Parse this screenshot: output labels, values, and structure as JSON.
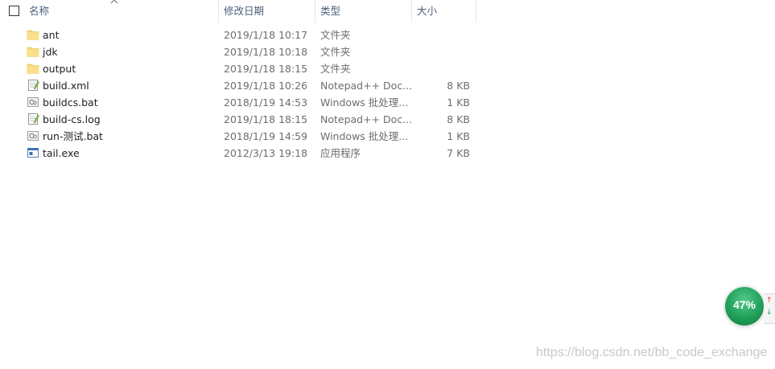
{
  "header": {
    "name": "名称",
    "date": "修改日期",
    "type": "类型",
    "size": "大小"
  },
  "files": [
    {
      "icon": "folder-icon",
      "name": "ant",
      "date": "2019/1/18 10:17",
      "type": "文件夹",
      "size": ""
    },
    {
      "icon": "folder-icon",
      "name": "jdk",
      "date": "2019/1/18 10:18",
      "type": "文件夹",
      "size": ""
    },
    {
      "icon": "folder-icon",
      "name": "output",
      "date": "2019/1/18 18:15",
      "type": "文件夹",
      "size": ""
    },
    {
      "icon": "notepad-icon",
      "name": "build.xml",
      "date": "2019/1/18 10:26",
      "type": "Notepad++ Doc...",
      "size": "8 KB"
    },
    {
      "icon": "bat-icon",
      "name": "buildcs.bat",
      "date": "2018/1/19 14:53",
      "type": "Windows 批处理...",
      "size": "1 KB"
    },
    {
      "icon": "notepad-icon",
      "name": "build-cs.log",
      "date": "2019/1/18 18:15",
      "type": "Notepad++ Doc...",
      "size": "8 KB"
    },
    {
      "icon": "bat-icon",
      "name": "run-测试.bat",
      "date": "2018/1/19 14:59",
      "type": "Windows 批处理...",
      "size": "1 KB"
    },
    {
      "icon": "exe-icon",
      "name": "tail.exe",
      "date": "2012/3/13 19:18",
      "type": "应用程序",
      "size": "7 KB"
    }
  ],
  "widget": {
    "percent": "47%"
  },
  "watermark": "https://blog.csdn.net/bb_code_exchange",
  "colors": {
    "header_text": "#4c607a",
    "folder": "#f8d775",
    "gauge": "#21a05a"
  }
}
